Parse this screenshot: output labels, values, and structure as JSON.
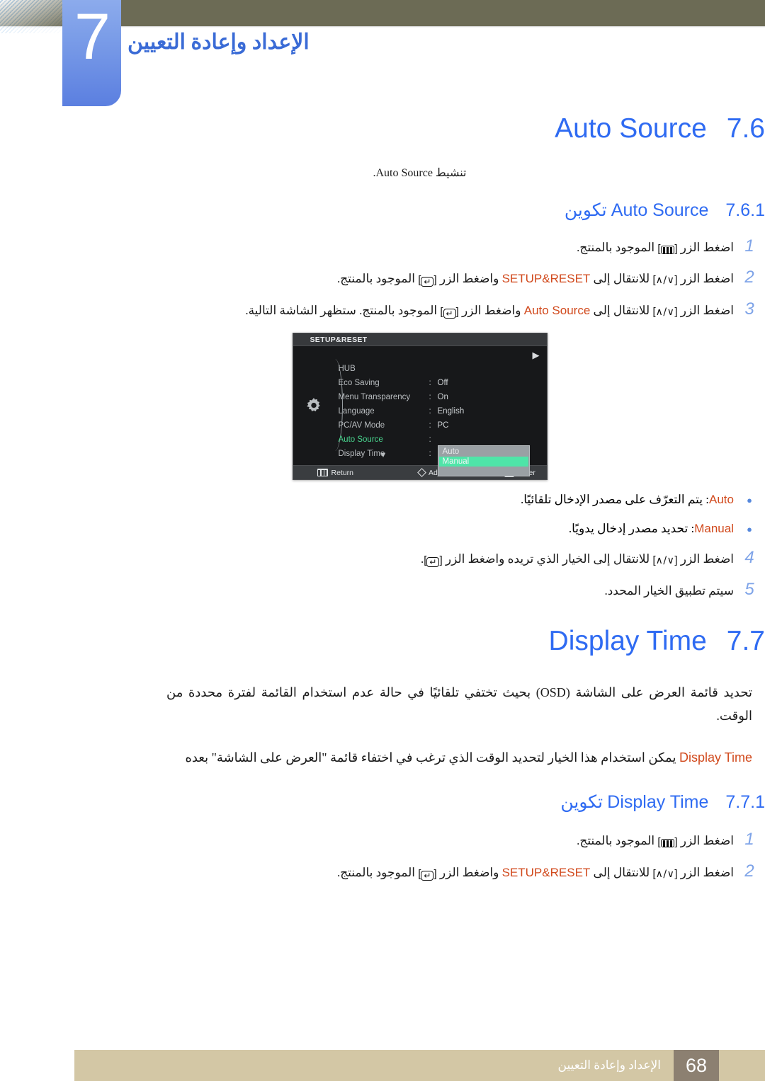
{
  "chapter": {
    "number": "7",
    "title": "الإعداد وإعادة التعيين"
  },
  "sections": [
    {
      "num": "7.6",
      "name": "Auto Source",
      "note": "تنشيط Auto Source.",
      "note_en": "Auto Source",
      "subsection": {
        "num": "7.6.1",
        "label_ar": "تكوين",
        "label_en": "Auto Source"
      }
    },
    {
      "num": "7.7",
      "name": "Display Time",
      "paragraph1": "تحديد قائمة العرض على الشاشة (OSD) بحيث تختفي تلقائيًا في حالة عدم استخدام القائمة لفترة محددة من الوقت.",
      "paragraph2_pre": "يمكن استخدام هذا الخيار لتحديد الوقت الذي ترغب في اختفاء قائمة \"العرض على الشاشة\" بعده",
      "paragraph2_en": "Display Time",
      "subsection": {
        "num": "7.7.1",
        "label_ar": "تكوين",
        "label_en": "Display Time"
      }
    }
  ],
  "steps_auto_source": [
    {
      "num": "1",
      "parts": [
        {
          "t": "text",
          "v": "اضغط الزر "
        },
        {
          "t": "key-menu"
        },
        {
          "t": "text",
          "v": " الموجود بالمنتج."
        }
      ]
    },
    {
      "num": "2",
      "parts": [
        {
          "t": "text",
          "v": "اضغط الزر "
        },
        {
          "t": "key-ud"
        },
        {
          "t": "text",
          "v": " للانتقال إلى "
        },
        {
          "t": "orange",
          "v": "SETUP&RESET"
        },
        {
          "t": "text",
          "v": " واضغط الزر "
        },
        {
          "t": "key-enter"
        },
        {
          "t": "text",
          "v": " الموجود بالمنتج."
        }
      ]
    },
    {
      "num": "3",
      "parts": [
        {
          "t": "text",
          "v": "اضغط الزر "
        },
        {
          "t": "key-ud"
        },
        {
          "t": "text",
          "v": " للانتقال إلى "
        },
        {
          "t": "orange",
          "v": "Auto Source"
        },
        {
          "t": "text",
          "v": " واضغط الزر "
        },
        {
          "t": "key-enter"
        },
        {
          "t": "text",
          "v": " الموجود بالمنتج. ستظهر الشاشة التالية."
        }
      ]
    }
  ],
  "bullets_auto_source": [
    {
      "term": "Auto",
      "desc": ": يتم التعرّف على مصدر الإدخال تلقائيًا."
    },
    {
      "term": "Manual",
      "desc": ": تحديد مصدر إدخال يدويًا."
    }
  ],
  "steps_auto_source_tail": [
    {
      "num": "4",
      "parts": [
        {
          "t": "text",
          "v": "اضغط الزر "
        },
        {
          "t": "key-ud"
        },
        {
          "t": "text",
          "v": " للانتقال إلى الخيار الذي تريده واضغط الزر "
        },
        {
          "t": "key-enter"
        },
        {
          "t": "text",
          "v": "."
        }
      ]
    },
    {
      "num": "5",
      "parts": [
        {
          "t": "text",
          "v": "سيتم تطبيق الخيار المحدد."
        }
      ]
    }
  ],
  "steps_display_time": [
    {
      "num": "1",
      "parts": [
        {
          "t": "text",
          "v": "اضغط الزر "
        },
        {
          "t": "key-menu"
        },
        {
          "t": "text",
          "v": " الموجود بالمنتج."
        }
      ]
    },
    {
      "num": "2",
      "parts": [
        {
          "t": "text",
          "v": "اضغط الزر "
        },
        {
          "t": "key-ud"
        },
        {
          "t": "text",
          "v": " للانتقال إلى "
        },
        {
          "t": "orange",
          "v": "SETUP&RESET"
        },
        {
          "t": "text",
          "v": " واضغط الزر "
        },
        {
          "t": "key-enter"
        },
        {
          "t": "text",
          "v": " الموجود بالمنتج."
        }
      ]
    }
  ],
  "osd": {
    "title": "SETUP&RESET",
    "rows": [
      {
        "label": "HUB",
        "colon": "",
        "value": "",
        "active": false
      },
      {
        "label": "Eco Saving",
        "colon": ":",
        "value": "Off",
        "active": false
      },
      {
        "label": "Menu Transparency",
        "colon": ":",
        "value": "On",
        "active": false
      },
      {
        "label": "Language",
        "colon": ":",
        "value": "English",
        "active": false
      },
      {
        "label": "PC/AV Mode",
        "colon": ":",
        "value": "PC",
        "active": false
      },
      {
        "label": "Auto Source",
        "colon": ":",
        "value": "",
        "active": true
      },
      {
        "label": "Display Time",
        "colon": ":",
        "value": "",
        "active": false
      }
    ],
    "dropdown": {
      "items": [
        {
          "label": "Auto",
          "selected": false
        },
        {
          "label": "Manual",
          "selected": true
        }
      ]
    },
    "footer": [
      {
        "icon": "menu-bars-icon",
        "label": "Return"
      },
      {
        "icon": "diamond-icon",
        "label": "Adjust"
      },
      {
        "icon": "enter-arrow-icon",
        "label": "Enter"
      }
    ],
    "right_arrow": "▶",
    "down_chevron": "▼"
  },
  "footer": {
    "page_number": "68",
    "text": "الإعداد وإعادة التعيين"
  },
  "colors": {
    "header_olive": "#6c6b55",
    "chapter_blue": "#5b7fe0",
    "heading_blue": "#2f6bf2",
    "accent_orange": "#d1491c",
    "step_num_blue": "#7fa4e8",
    "footer_tan": "#d3c7a5",
    "footer_brown": "#8c8071",
    "osd_green": "#49d68f",
    "osd_highlight": "#4fe5a8"
  }
}
